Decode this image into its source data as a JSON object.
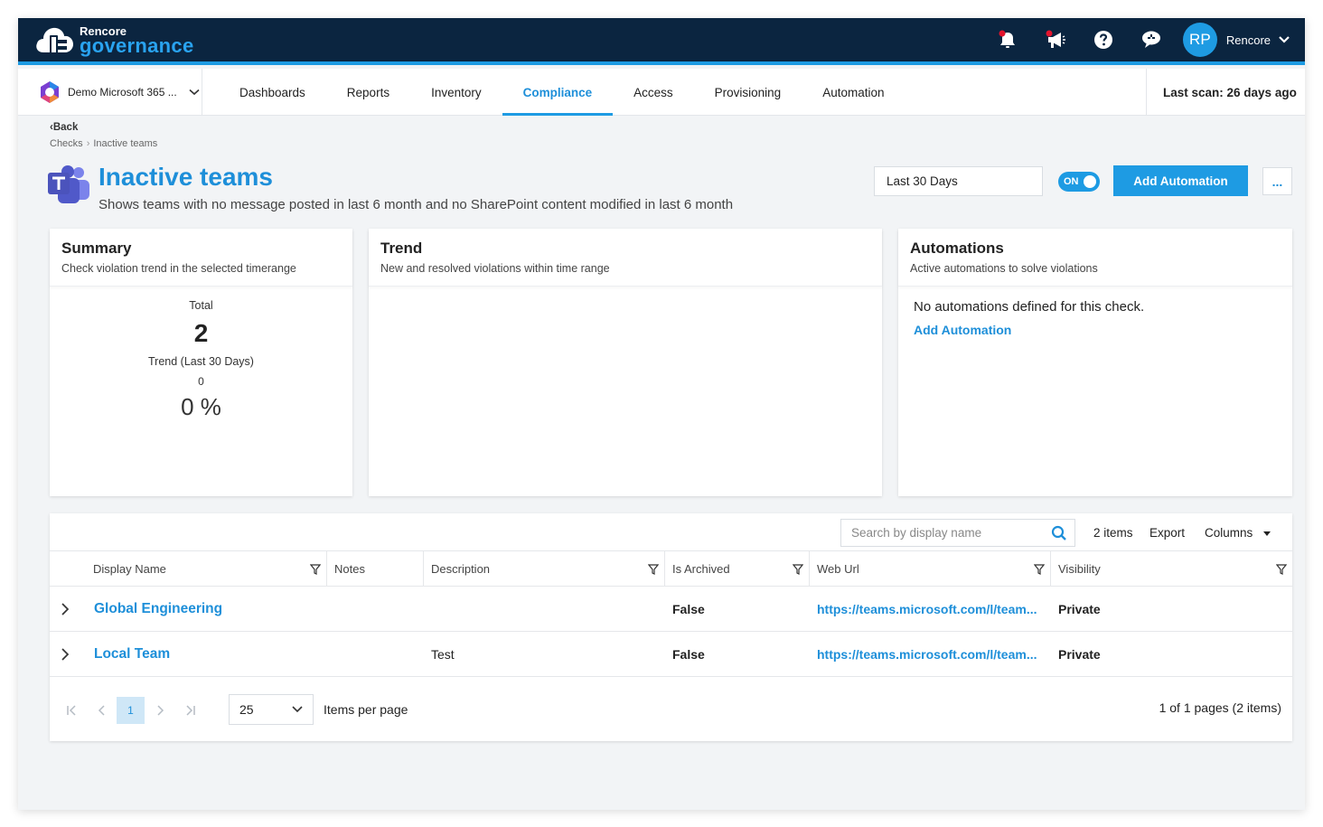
{
  "app": {
    "logo_small": "Rencore",
    "logo_big": "governance"
  },
  "header": {
    "user_initials": "RP",
    "user_name": "Rencore",
    "icons": [
      "bell-icon",
      "megaphone-icon",
      "help-icon",
      "feedback-icon"
    ]
  },
  "nav": {
    "tenant": "Demo Microsoft 365 ...",
    "tabs": [
      {
        "label": "Dashboards",
        "active": false
      },
      {
        "label": "Reports",
        "active": false
      },
      {
        "label": "Inventory",
        "active": false
      },
      {
        "label": "Compliance",
        "active": true
      },
      {
        "label": "Access",
        "active": false
      },
      {
        "label": "Provisioning",
        "active": false
      },
      {
        "label": "Automation",
        "active": false
      }
    ],
    "last_scan": "Last scan:  26 days ago"
  },
  "breadcrumb": {
    "back": "Back",
    "items": [
      "Checks",
      "Inactive teams"
    ]
  },
  "page": {
    "title": "Inactive teams",
    "subtitle": "Shows teams with no message posted in last 6 month and no SharePoint content modified in last 6 month",
    "range": "Last 30 Days",
    "toggle_label": "ON",
    "add_automation": "Add Automation",
    "more": "..."
  },
  "summary": {
    "title": "Summary",
    "subtitle": "Check violation trend in the selected timerange",
    "total_label": "Total",
    "total": "2",
    "trend_label": "Trend (Last 30 Days)",
    "trend_value": "0",
    "trend_pct": "0 %"
  },
  "trend": {
    "title": "Trend",
    "subtitle": "New and resolved violations within time range"
  },
  "automations": {
    "title": "Automations",
    "subtitle": "Active automations to solve violations",
    "empty": "No automations defined for this check.",
    "add_link": "Add Automation"
  },
  "table": {
    "search_placeholder": "Search by display name",
    "count": "2 items",
    "export": "Export",
    "columns": "Columns",
    "headers": {
      "display_name": "Display Name",
      "notes": "Notes",
      "description": "Description",
      "is_archived": "Is Archived",
      "web_url": "Web Url",
      "visibility": "Visibility"
    },
    "rows": [
      {
        "display_name": "Global Engineering",
        "notes": "",
        "description": "",
        "is_archived": "False",
        "web_url": "https://teams.microsoft.com/l/team...",
        "visibility": "Private"
      },
      {
        "display_name": "Local Team",
        "notes": "",
        "description": "Test",
        "is_archived": "False",
        "web_url": "https://teams.microsoft.com/l/team...",
        "visibility": "Private"
      }
    ]
  },
  "pager": {
    "current_page": "1",
    "page_size": "25",
    "items_per_page": "Items per page",
    "info": "1 of 1 pages (2 items)"
  },
  "colors": {
    "header_bg": "#0b2540",
    "accent": "#1e9be3",
    "link": "#1e8fd9"
  }
}
